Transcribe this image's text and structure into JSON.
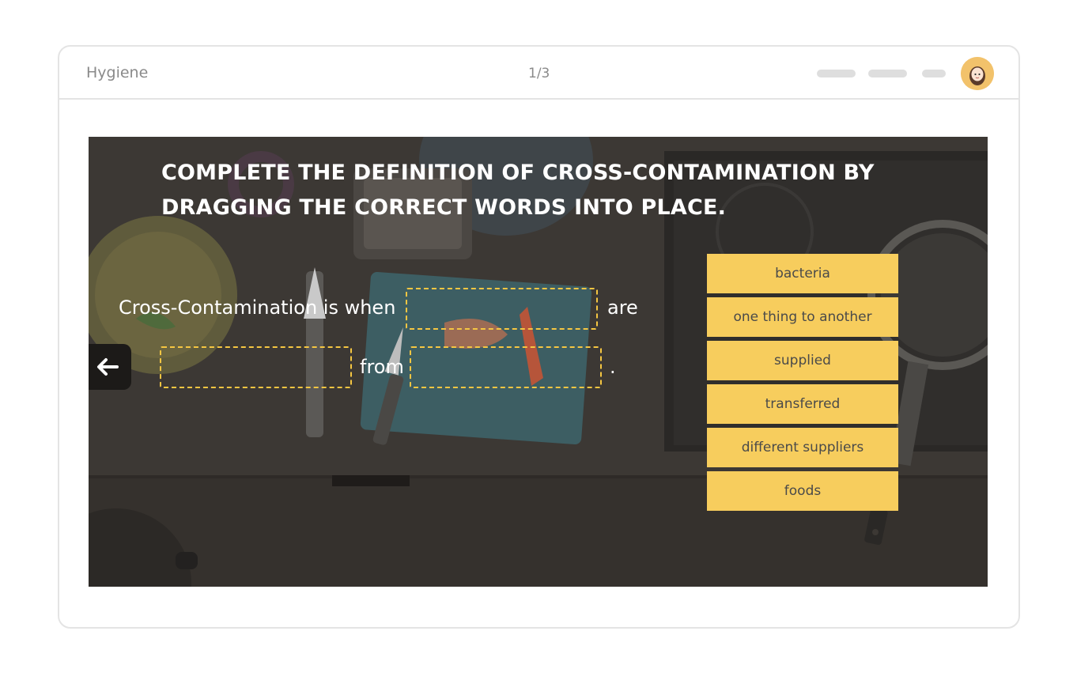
{
  "header": {
    "title": "Hygiene",
    "page_indicator": "1/3"
  },
  "activity": {
    "instruction": "COMPLETE THE DEFINITION OF CROSS-CONTAMINATION BY DRAGGING THE CORRECT WORDS INTO PLACE.",
    "sentence": {
      "part1": "Cross-Contamination is when",
      "part2": "are",
      "part3": "from",
      "part4": "."
    },
    "word_bank": [
      "bacteria",
      "one thing to another",
      "supplied",
      "transferred",
      "different suppliers",
      "foods"
    ]
  },
  "icons": {
    "back": "arrow-left-icon",
    "avatar": "user-avatar-icon"
  },
  "colors": {
    "chip": "#f7cd5d",
    "drop_zone_border": "#f5c642",
    "stage_background": "#3a3632",
    "card_border": "#e4e4e4"
  }
}
